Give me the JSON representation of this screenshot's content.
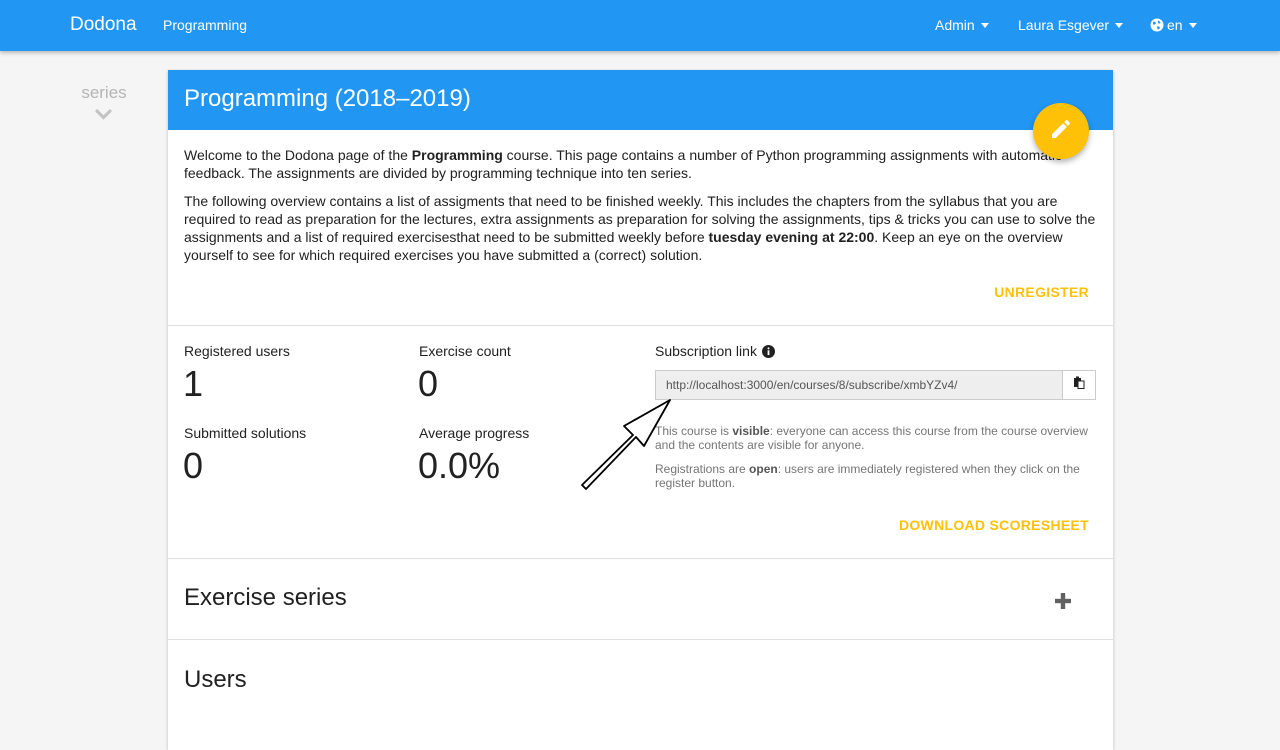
{
  "navbar": {
    "brand": "Dodona",
    "course": "Programming",
    "admin": "Admin",
    "user": "Laura Esgever",
    "language": "en"
  },
  "sidebar": {
    "series_label": "series"
  },
  "course": {
    "title": "Programming (2018–2019)",
    "intro1_a": "Welcome to the Dodona page of the ",
    "intro1_bold": "Programming",
    "intro1_b": " course. This page contains a number of Python programming assignments with automatic feedback. The assignments are divided by programming technique into ten series.",
    "intro2_a": "The following overview contains a list of assigments that need to be finished weekly. This includes the chapters from the syllabus that you are required to read as preparation for the lectures, extra assignments as preparation for solving the assignments, tips & tricks you can use to solve the assignments and a list of required exercisesthat need to be submitted weekly before ",
    "intro2_bold": "tuesday evening at 22:00",
    "intro2_b": ". Keep an eye on the overview yourself to see for which required exercises you have submitted a (correct) solution.",
    "unregister": "UNREGISTER"
  },
  "stats": {
    "registered_users_label": "Registered users",
    "registered_users": "1",
    "exercise_count_label": "Exercise count",
    "exercise_count": "0",
    "submitted_solutions_label": "Submitted solutions",
    "submitted_solutions": "0",
    "average_progress_label": "Average progress",
    "average_progress": "0.0%"
  },
  "subscription": {
    "label": "Subscription link",
    "link": "http://localhost:3000/en/courses/8/subscribe/xmbYZv4/",
    "visible_a": "This course is ",
    "visible_bold": "visible",
    "visible_b": ": everyone can access this course from the course overview and the contents are visible for anyone.",
    "open_a": "Registrations are ",
    "open_bold": "open",
    "open_b": ": users are immediately registered when they click on the register button.",
    "download": "DOWNLOAD SCORESHEET"
  },
  "sections": {
    "exercise_series": "Exercise series",
    "users": "Users"
  },
  "colors": {
    "primary": "#2196f3",
    "accent": "#ffc107"
  }
}
